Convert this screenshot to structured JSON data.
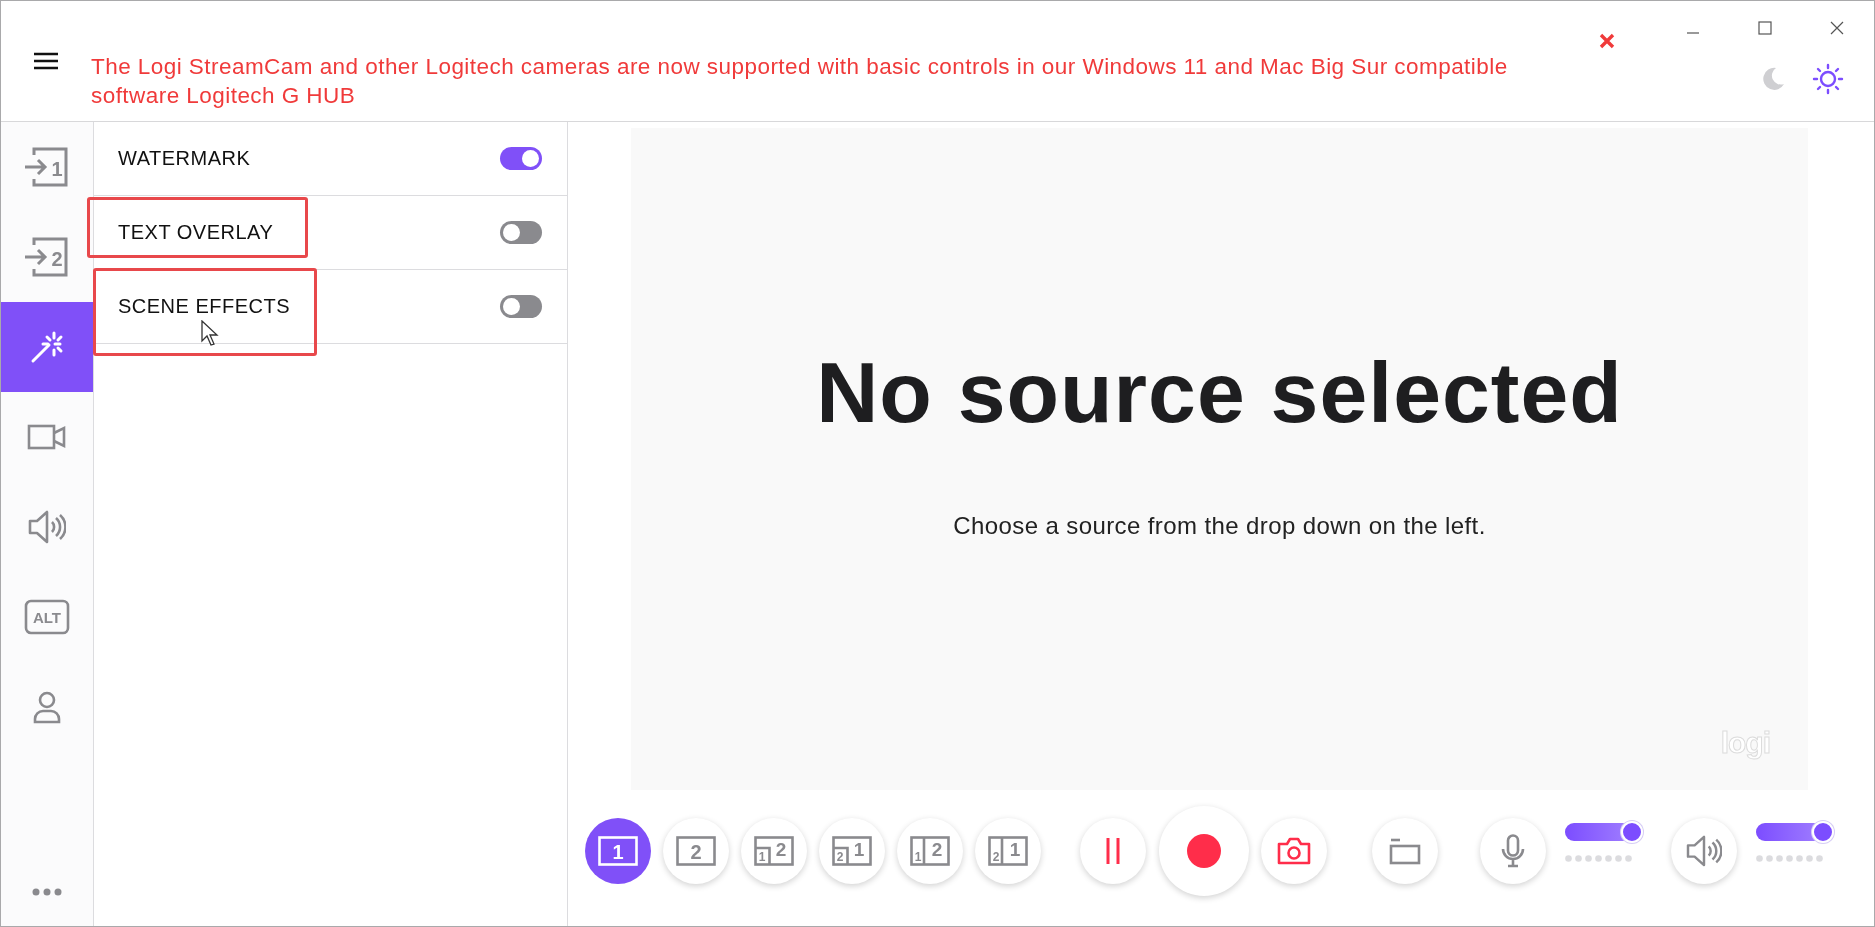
{
  "banner": {
    "message": "The Logi StreamCam and other Logitech cameras are now supported with basic controls in our Windows 11 and Mac Big Sur compatible software Logitech G HUB",
    "dismissible": true
  },
  "theme_options": [
    {
      "kind": "dark",
      "selected": false
    },
    {
      "kind": "light",
      "selected": true
    }
  ],
  "sidebar": {
    "items": [
      {
        "kind": "input",
        "label": "1",
        "selected": false
      },
      {
        "kind": "input",
        "label": "2",
        "selected": false
      },
      {
        "kind": "effects",
        "selected": true
      },
      {
        "kind": "camera",
        "selected": false
      },
      {
        "kind": "audio",
        "selected": false
      },
      {
        "kind": "alt",
        "label": "ALT",
        "selected": false
      },
      {
        "kind": "profile",
        "selected": false
      }
    ]
  },
  "effects": [
    {
      "label": "WATERMARK",
      "on": true,
      "highlighted": false
    },
    {
      "label": "TEXT OVERLAY",
      "on": false,
      "highlighted": true
    },
    {
      "label": "SCENE EFFECTS",
      "on": false,
      "highlighted": true
    }
  ],
  "preview": {
    "title": "No source selected",
    "message": "Choose a source from the drop down on the left.",
    "logo": "logi"
  },
  "layouts": [
    {
      "kind": "single",
      "digits": [
        "1"
      ],
      "selected": true
    },
    {
      "kind": "single",
      "digits": [
        "2"
      ],
      "selected": false
    },
    {
      "kind": "pip",
      "digits": [
        "1",
        "2"
      ],
      "selected": false
    },
    {
      "kind": "pip",
      "digits": [
        "2",
        "1"
      ],
      "selected": false
    },
    {
      "kind": "split",
      "digits": [
        "1",
        "2"
      ],
      "selected": false
    },
    {
      "kind": "split",
      "digits": [
        "2",
        "1"
      ],
      "selected": false
    }
  ],
  "audio": [
    {
      "kind": "microphone",
      "level": 1
    },
    {
      "kind": "speaker",
      "level": 1
    }
  ]
}
